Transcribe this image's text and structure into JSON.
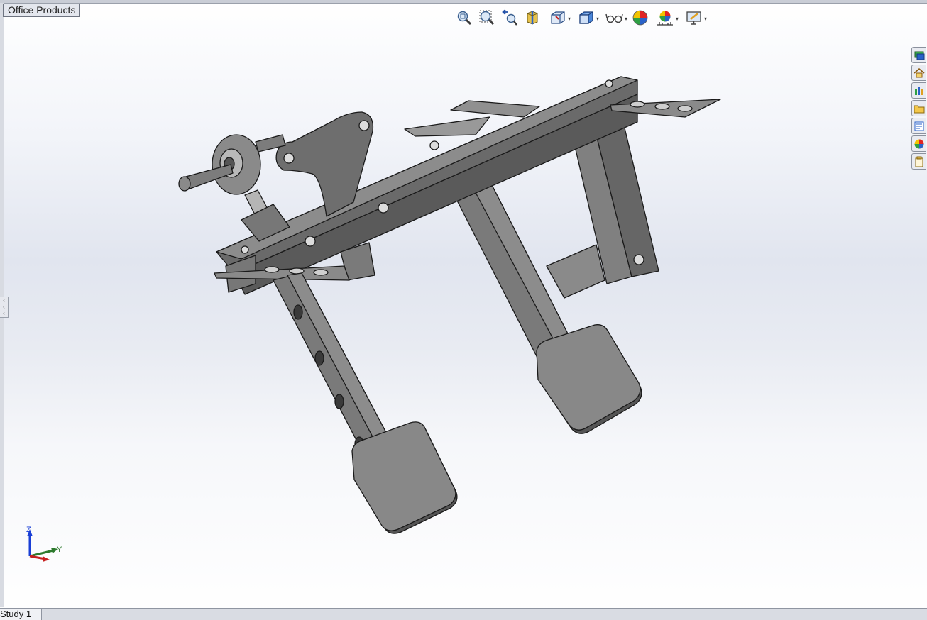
{
  "window": {
    "tab_label": "Office Products"
  },
  "heads_up_toolbar": [
    {
      "name": "zoom-to-fit-icon"
    },
    {
      "name": "zoom-to-area-icon"
    },
    {
      "name": "previous-view-icon"
    },
    {
      "name": "section-view-icon"
    },
    {
      "name": "view-orientation-icon",
      "has_menu": true
    },
    {
      "name": "display-style-icon",
      "has_menu": true
    },
    {
      "name": "hide-show-items-icon",
      "has_menu": true
    },
    {
      "name": "edit-appearance-icon"
    },
    {
      "name": "apply-scene-icon",
      "has_menu": true
    },
    {
      "name": "view-settings-icon",
      "has_menu": true
    }
  ],
  "task_pane_tabs": [
    {
      "name": "solidworks-resources-icon"
    },
    {
      "name": "home-icon"
    },
    {
      "name": "design-library-icon"
    },
    {
      "name": "file-explorer-icon"
    },
    {
      "name": "view-palette-icon"
    },
    {
      "name": "appearances-scenes-icon"
    },
    {
      "name": "custom-properties-icon"
    }
  ],
  "triad": {
    "z_label": "Z",
    "y_label": "Y",
    "colors": {
      "z": "#1a3fd6",
      "y": "#2d7a2d",
      "x": "#c62020"
    }
  },
  "bottom_tabs": {
    "study_label": "Study 1"
  },
  "colors": {
    "part_fill": "#6e6e6e",
    "part_light": "#8a8a8a",
    "part_dark": "#555555",
    "edge": "#1a1a1a"
  }
}
